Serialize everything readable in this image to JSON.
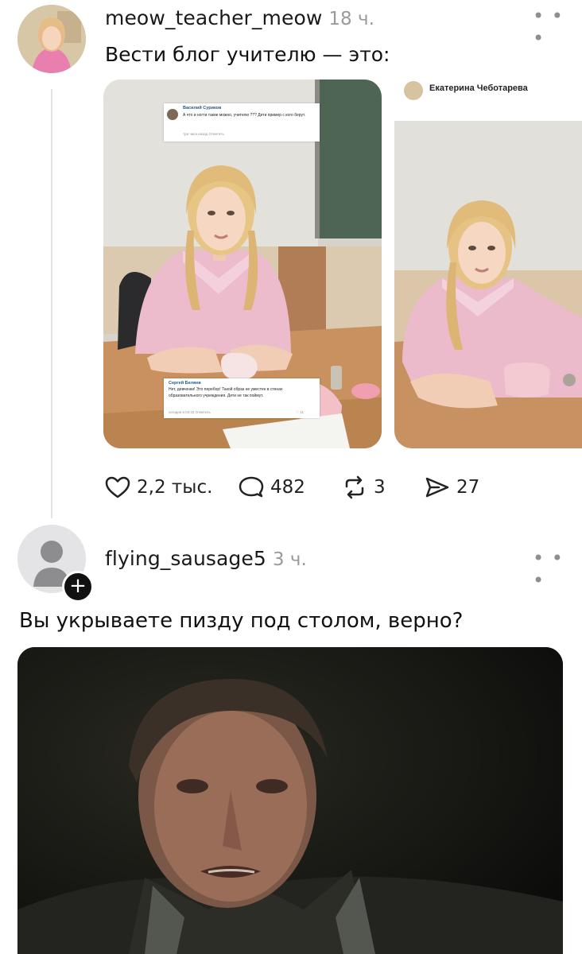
{
  "post": {
    "username": "meow_teacher_meow",
    "time": "18 ч.",
    "text": "Вести блог учителю — это:",
    "more_icon": "more-horizontal-icon",
    "image1": {
      "comment_top": {
        "author": "Василий Суриков",
        "text": "А что и ногти такие можно, учителю ??? Дети пример с кого берут.",
        "meta": "три часа назад  Ответить"
      },
      "comment_bottom": {
        "author": "Сергей Беляев",
        "text": "Нет, девчонки! Это перебор! Такой образ не уместен в стенах образовательного учреждения. Дети не так поймут.",
        "meta": "сегодня в 04:33  Ответить",
        "likes": "11"
      }
    },
    "image2": {
      "author": "Екатерина Чеботарева"
    },
    "actions": {
      "likes": "2,2 тыс.",
      "comments": "482",
      "reposts": "3",
      "shares": "27"
    }
  },
  "reply": {
    "username": "flying_sausage5",
    "time": "3 ч.",
    "text": "Вы укрываете пизду под столом, верно?",
    "more_icon": "more-horizontal-icon"
  },
  "colors": {
    "blouse": "#e9b8c8",
    "board": "#4c6152",
    "desk": "#c89266",
    "text_muted": "#9a9a9a"
  }
}
